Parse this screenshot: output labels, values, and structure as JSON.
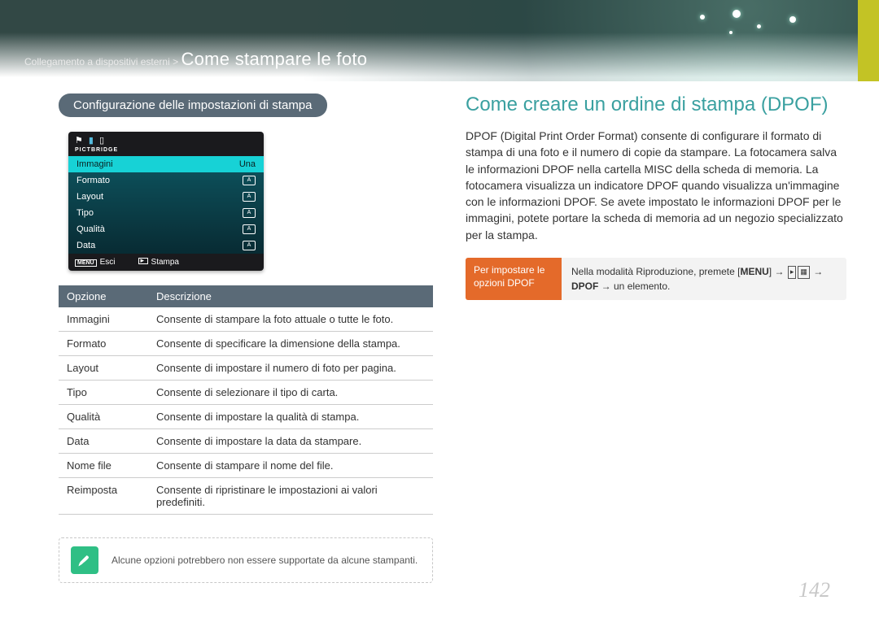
{
  "breadcrumb": {
    "path": "Collegamento a dispositivi esterni >",
    "title": "Come stampare le foto"
  },
  "left": {
    "pill": "Configurazione delle impostazioni di stampa",
    "cam": {
      "pictbridge": "PICTBRIDGE",
      "rows": [
        {
          "label": "Immagini",
          "value": "Una",
          "selected": true
        },
        {
          "label": "Formato",
          "value_icon": "A"
        },
        {
          "label": "Layout",
          "value_icon": "A"
        },
        {
          "label": "Tipo",
          "value_icon": "A"
        },
        {
          "label": "Qualità",
          "value_icon": "A"
        },
        {
          "label": "Data",
          "value_icon": "A"
        }
      ],
      "foot_left": "Esci",
      "foot_right": "Stampa"
    },
    "table": {
      "head_opt": "Opzione",
      "head_desc": "Descrizione",
      "rows": [
        {
          "opt": "Immagini",
          "desc": "Consente di stampare la foto attuale o tutte le foto."
        },
        {
          "opt": "Formato",
          "desc": "Consente di specificare la dimensione della stampa."
        },
        {
          "opt": "Layout",
          "desc": "Consente di impostare il numero di foto per pagina."
        },
        {
          "opt": "Tipo",
          "desc": "Consente di selezionare il tipo di carta."
        },
        {
          "opt": "Qualità",
          "desc": "Consente di impostare la qualità di stampa."
        },
        {
          "opt": "Data",
          "desc": "Consente di impostare la data da stampare."
        },
        {
          "opt": "Nome file",
          "desc": "Consente di stampare il nome del file."
        },
        {
          "opt": "Reimposta",
          "desc": "Consente di ripristinare le impostazioni ai valori predefiniti."
        }
      ]
    },
    "note": "Alcune opzioni potrebbero non essere supportate da alcune stampanti."
  },
  "right": {
    "h2": "Come creare un ordine di stampa (DPOF)",
    "body": "DPOF (Digital Print Order Format) consente di configurare il formato di stampa di una foto e il numero di copie da stampare. La fotocamera salva le informazioni DPOF nella cartella MISC della scheda di memoria. La fotocamera visualizza un indicatore DPOF quando visualizza un'immagine con le informazioni DPOF. Se avete impostato le informazioni DPOF per le immagini, potete portare la scheda di memoria ad un negozio specializzato per la stampa.",
    "callout": {
      "left": "Per impostare le opzioni DPOF",
      "right_pre": "Nella modalità Riproduzione, premete [",
      "right_menu": "MENU",
      "right_mid": "] → ",
      "right_dpof": "DPOF",
      "right_post": " → un elemento."
    }
  },
  "page_number": "142"
}
